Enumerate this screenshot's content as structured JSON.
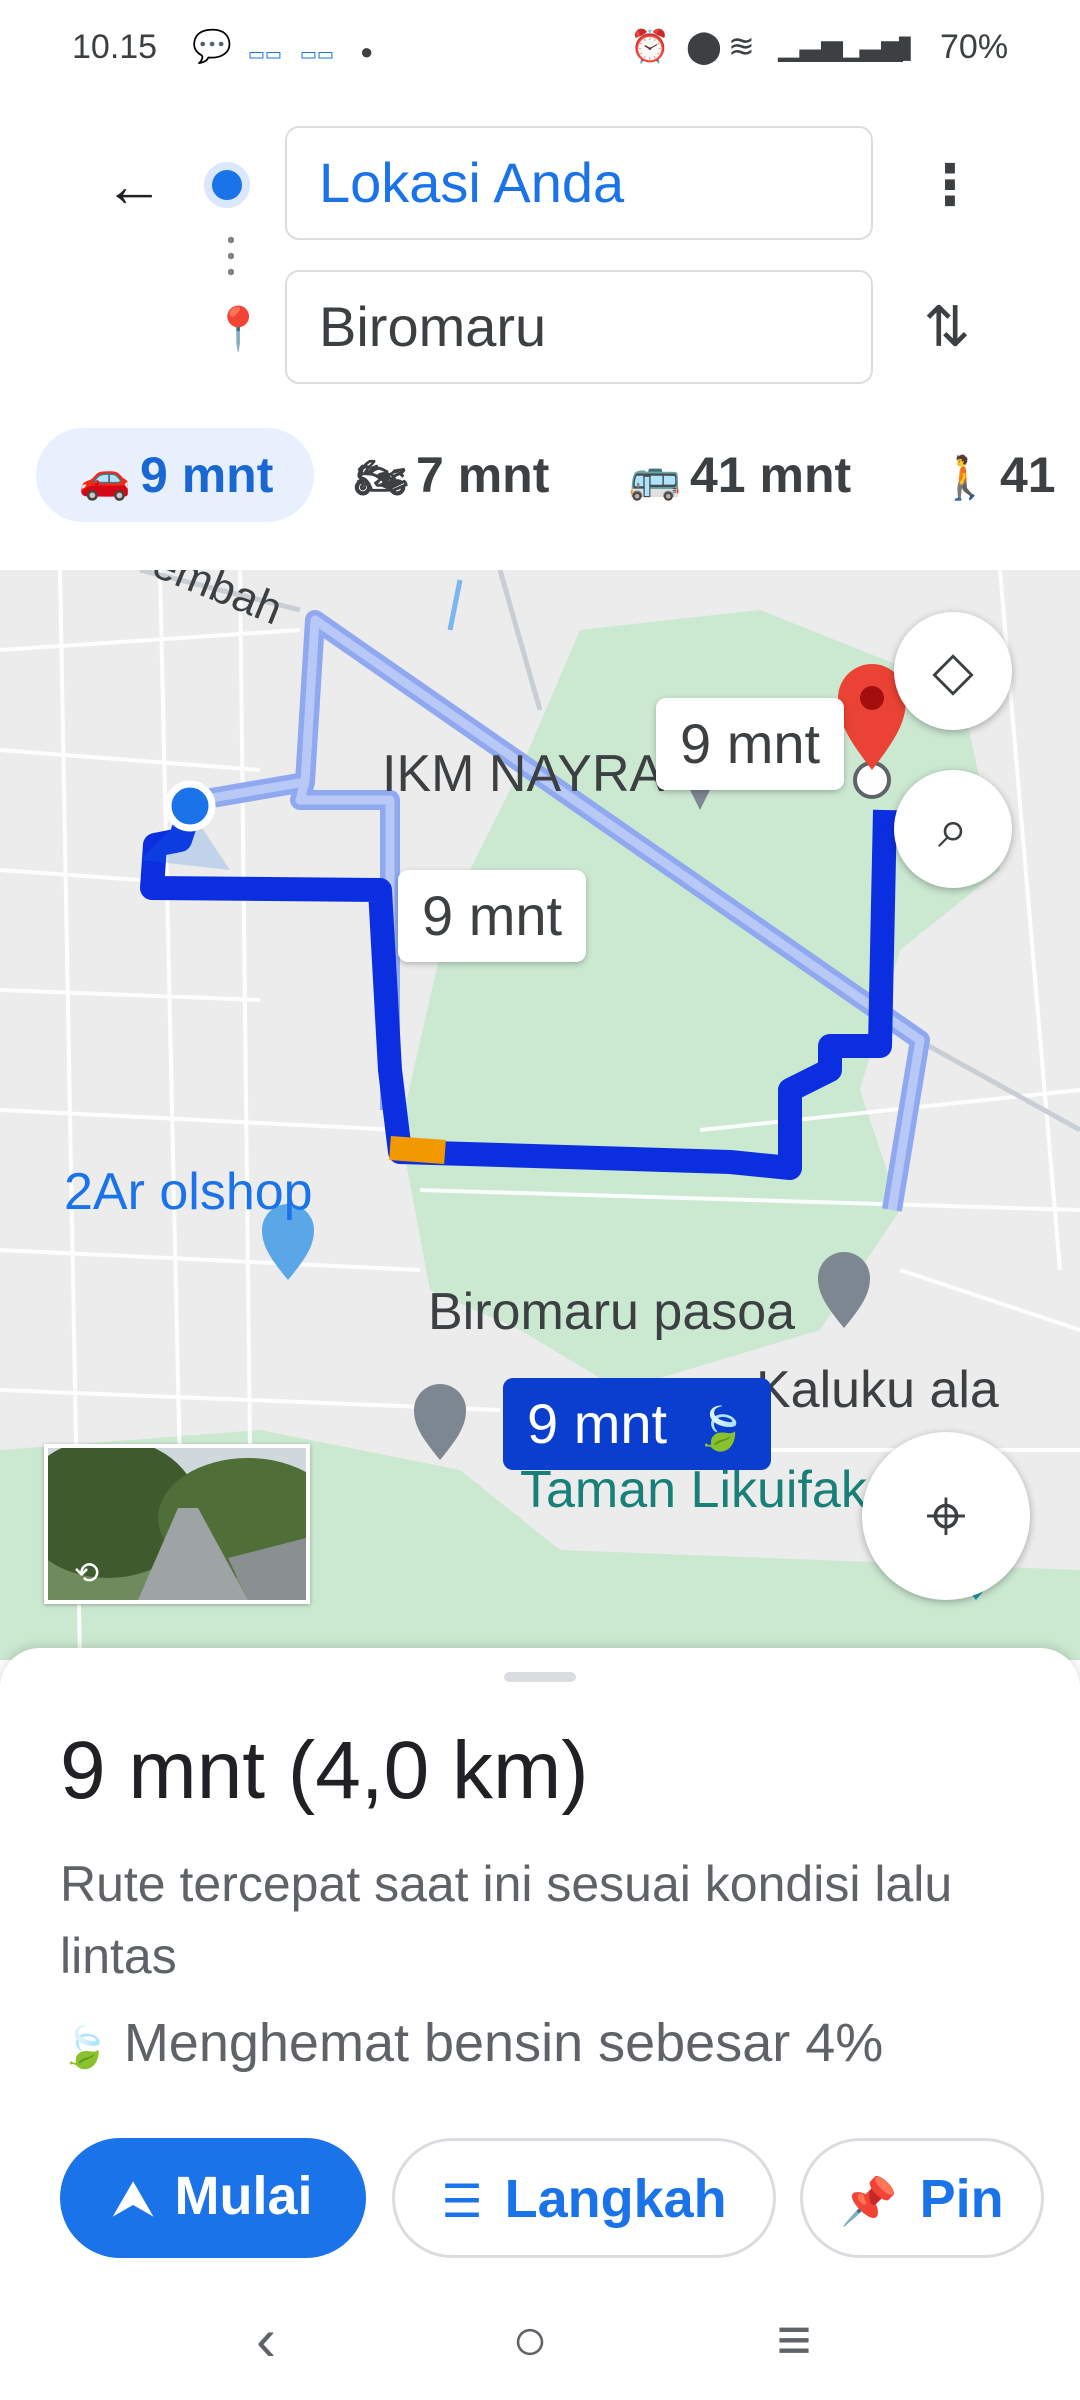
{
  "status_bar": {
    "time": "10.15",
    "battery": "70%",
    "icons": [
      "chat-bubble-icon",
      "app-icon",
      "app-icon",
      "dot-icon",
      "alarm-icon",
      "location-icon",
      "wifi-icon",
      "signal-icon",
      "signal-icon",
      "battery-icon"
    ]
  },
  "search": {
    "origin": "Lokasi Anda",
    "destination": "Biromaru"
  },
  "modes": [
    {
      "name": "car",
      "time": "9 mnt",
      "selected": true
    },
    {
      "name": "motorcycle",
      "time": "7 mnt"
    },
    {
      "name": "transit",
      "time": "41 mnt"
    },
    {
      "name": "walk",
      "time": "41"
    }
  ],
  "map": {
    "labels": {
      "road": "embah",
      "ikm": "IKM NAYRA",
      "olshop": "2Ar olshop",
      "biromaru_pasoa": "Biromaru pasoa",
      "kalukuda": "Kaluku ala",
      "taman": "Taman Likuifaksi"
    },
    "eta_alt1": "9 mnt",
    "eta_alt2": "9 mnt",
    "eta_main": "9 mnt"
  },
  "sheet": {
    "duration": "9 mnt",
    "distance": "(4,0 km)",
    "description": "Rute tercepat saat ini sesuai kondisi lalu lintas",
    "eco_note": "Menghemat bensin sebesar 4%",
    "start_label": "Mulai",
    "steps_label": "Langkah",
    "pin_label": "Pin"
  },
  "colors": {
    "accent": "#1a73e8",
    "route_main": "#0b2fe0",
    "route_alt": "#a9bdf5",
    "destination_pin": "#d93025"
  }
}
